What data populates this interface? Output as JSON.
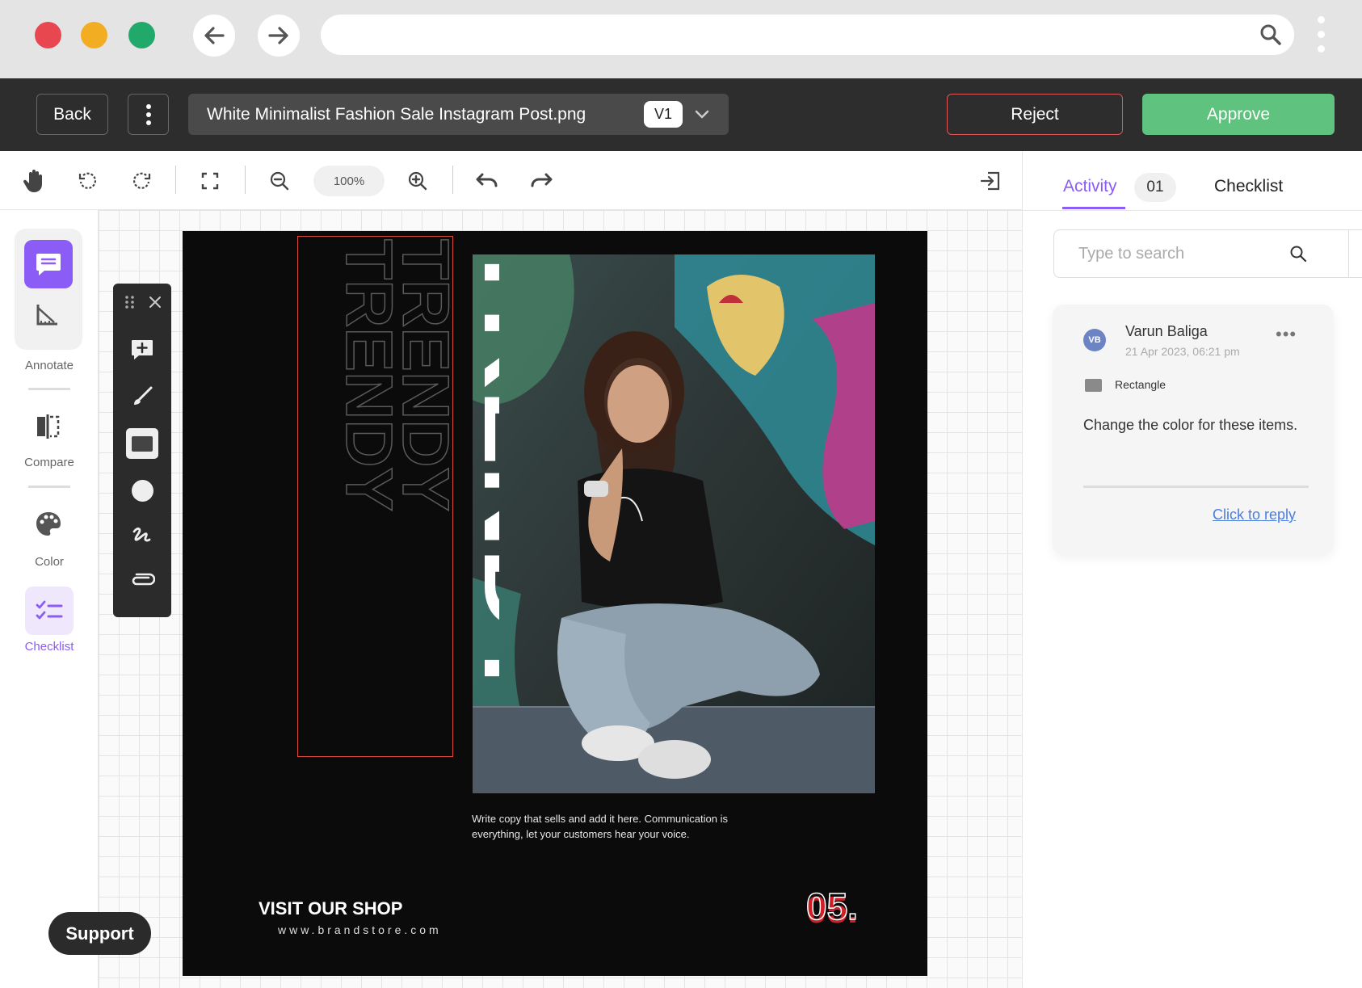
{
  "browser": {
    "window_dots": {
      "red": "#e8474f",
      "yellow": "#f2ad22",
      "green": "#21a96c"
    }
  },
  "header": {
    "back_label": "Back",
    "file_name": "White Minimalist Fashion Sale Instagram Post.png",
    "version": "V1",
    "reject_label": "Reject",
    "approve_label": "Approve",
    "colors": {
      "approve": "#5fc27e",
      "reject_border": "#e05555"
    }
  },
  "toolbar": {
    "zoom": "100%",
    "icons": [
      "hand-icon",
      "rotate-left-icon",
      "rotate-right-icon",
      "fit-screen-icon",
      "zoom-out-icon",
      "zoom-in-icon",
      "undo-icon",
      "redo-icon",
      "exit-panel-icon"
    ]
  },
  "rail": {
    "annotate_label": "Annotate",
    "compare_label": "Compare",
    "color_label": "Color",
    "checklist_label": "Checklist",
    "accent": "#8b5cf6"
  },
  "palette": {
    "tools": [
      "add-comment-icon",
      "brush-icon",
      "rectangle-icon",
      "circle-icon",
      "freehand-icon",
      "attachment-icon"
    ]
  },
  "artwork": {
    "headline": "TRENDY",
    "copy": "Write copy that sells and add it here. Communication is everything, let your customers hear your voice.",
    "cta": "VISIT OUR SHOP",
    "website": "www.brandstore.com",
    "number": "05."
  },
  "support_label": "Support",
  "panel": {
    "tab_activity": "Activity",
    "activity_count": "01",
    "tab_checklist": "Checklist",
    "search_placeholder": "Type to search",
    "comment": {
      "initials": "VB",
      "author": "Varun Baliga",
      "date": "21 Apr 2023, 06:21 pm",
      "shape": "Rectangle",
      "text": "Change the color for these items.",
      "reply_label": "Click to reply"
    }
  }
}
